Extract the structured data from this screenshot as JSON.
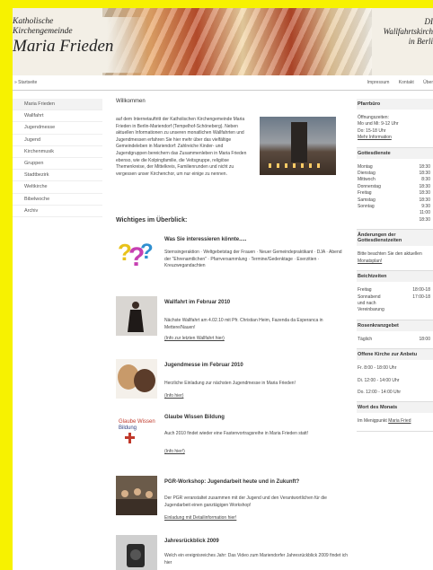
{
  "header": {
    "logo_line1": "Katholische",
    "logo_line2": "Kirchengemeinde",
    "logo_line3": "Maria Frieden",
    "right_line1": "DI",
    "right_line2": "Wallfahrtskirch",
    "right_line3": "in Berli"
  },
  "nav": {
    "home": "» Startseite",
    "links": [
      "Impressum",
      "Kontakt",
      "Über"
    ]
  },
  "sidebar": {
    "items": [
      "Maria Frieden",
      "Wallfahrt",
      "Jugendmesse",
      "Jugend",
      "Kirchenmusik",
      "Gruppen",
      "Stadtbezirk",
      "Weltkirche",
      "Bibelwoche",
      "Archiv"
    ]
  },
  "main": {
    "welcome_title": "Willkommen",
    "welcome_text": "auf dem Internetauftritt der Katholischen Kirchengemeinde Maria Frieden in Berlin-Mariendorf (Tempelhof-Schöneberg). Neben aktuellen Informationen zu unseren monatlichen Wallfahrten und Jugendmessen erfahren Sie hier mehr über das vielfältige Gemeindeleben in Mariendorf: Zahlreiche Kinder- und Jugendgruppen bereichern das Zusammenleben in Maria Frieden ebenso, wie die Kolpingfamilie, die Veitsgruppe, religiöse Themenkreise, der Mittelkreis, Familienrunden und nicht zu vergessen unser Kirchenchor, um nur einige zu nennen.",
    "overview_title": "Wichtiges im Überblick:",
    "blocks": [
      {
        "title": "Was Sie interessieren könnte.....",
        "text": "Sternsingeraktion · Weltgebetstag der Frauen · Neuer Gemeindepraktikant · DJA · Abend der \"Ehrenamtlichen\" · Pfarrversammlung · Termine/Gedenktage · Exerzitien · Kreuzwegandachten",
        "link": ""
      },
      {
        "title": "Wallfahrt im Februar 2010",
        "text": "Nächste Wallfahrt am 4.02.10 mit Pfr. Christian Heim, Fazenda da Esperanca in Mettere/Nauen!",
        "link": "(Info zur letzten Wallfahrt hier)"
      },
      {
        "title": "Jugendmesse im Februar 2010",
        "text": "Herzliche Einladung zur nächsten Jugendmesse in Maria Frieden!",
        "link": "(Info hier)"
      },
      {
        "title": "Glaube Wissen Bildung",
        "text": "Auch 2010 findet wieder eine Fastenvortragsreihe in Maria Frieden statt!",
        "link": "(Info hier!)"
      },
      {
        "title": "PGR-Workshop: Jugendarbeit heute und in Zukunft?",
        "text": "Der PGR veranstaltet zusammen mit der Jugend und den Verantwortlichen für die Jugendarbeit einen ganztägigen Workshop!",
        "link": "Einladung mit Detailinformation hier!"
      },
      {
        "title": "Jahresrückblick 2009",
        "text": "Welch ein ereignisreiches Jahr: Das Video zum Mariendorfer Jahresrückblick 2009 findet ich hier",
        "link": ""
      }
    ],
    "thumb_labels": {
      "glaube": "Glaube Wissen Bildung"
    }
  },
  "right": {
    "pfarrbuero": {
      "title": "Pfarrbüro",
      "lines": [
        "Öffnungszeiten:",
        "Mo und Mi: 9-12 Uhr",
        "Do: 15-18 Uhr"
      ],
      "link": "Mehr Information"
    },
    "gottesdienste": {
      "title": "Gottesdienste",
      "rows": [
        [
          "Montag",
          "18:30"
        ],
        [
          "Dienstag",
          "18:30"
        ],
        [
          "Mittwoch",
          "8:30"
        ],
        [
          "Donnerstag",
          "18:30"
        ],
        [
          "Freitag",
          "18:30"
        ],
        [
          "Samstag",
          "18:30"
        ],
        [
          "Sonntag",
          "9:30"
        ],
        [
          "",
          "11:00"
        ],
        [
          "",
          "18:30"
        ]
      ]
    },
    "aenderungen": {
      "title": "Änderungen der Gottesdienstzeiten",
      "text": "Bitte beachten Sie den aktuellen",
      "link": "Monatsplan!"
    },
    "beichte": {
      "title": "Beichtzeiten",
      "rows": [
        [
          "Freitag",
          "18:00-18"
        ],
        [
          "Sonnabend",
          "17:00-18"
        ]
      ],
      "extra": [
        "und nach",
        "Vereinbarung"
      ]
    },
    "rosenkranz": {
      "title": "Rosenkranzgebet",
      "rows": [
        [
          "Täglich",
          "18:00"
        ]
      ]
    },
    "offene": {
      "title": "Offene Kirche zur Anbetu",
      "lines": [
        "Fr. 8:00 - 18:00 Uhr",
        "Di. 12:00 - 14:00 Uhr",
        "Do. 12:00 - 14:00 Uhr"
      ]
    },
    "wort": {
      "title": "Wort des Monats",
      "text": "Im Menigpunkt",
      "link": "Maria Fried"
    }
  }
}
